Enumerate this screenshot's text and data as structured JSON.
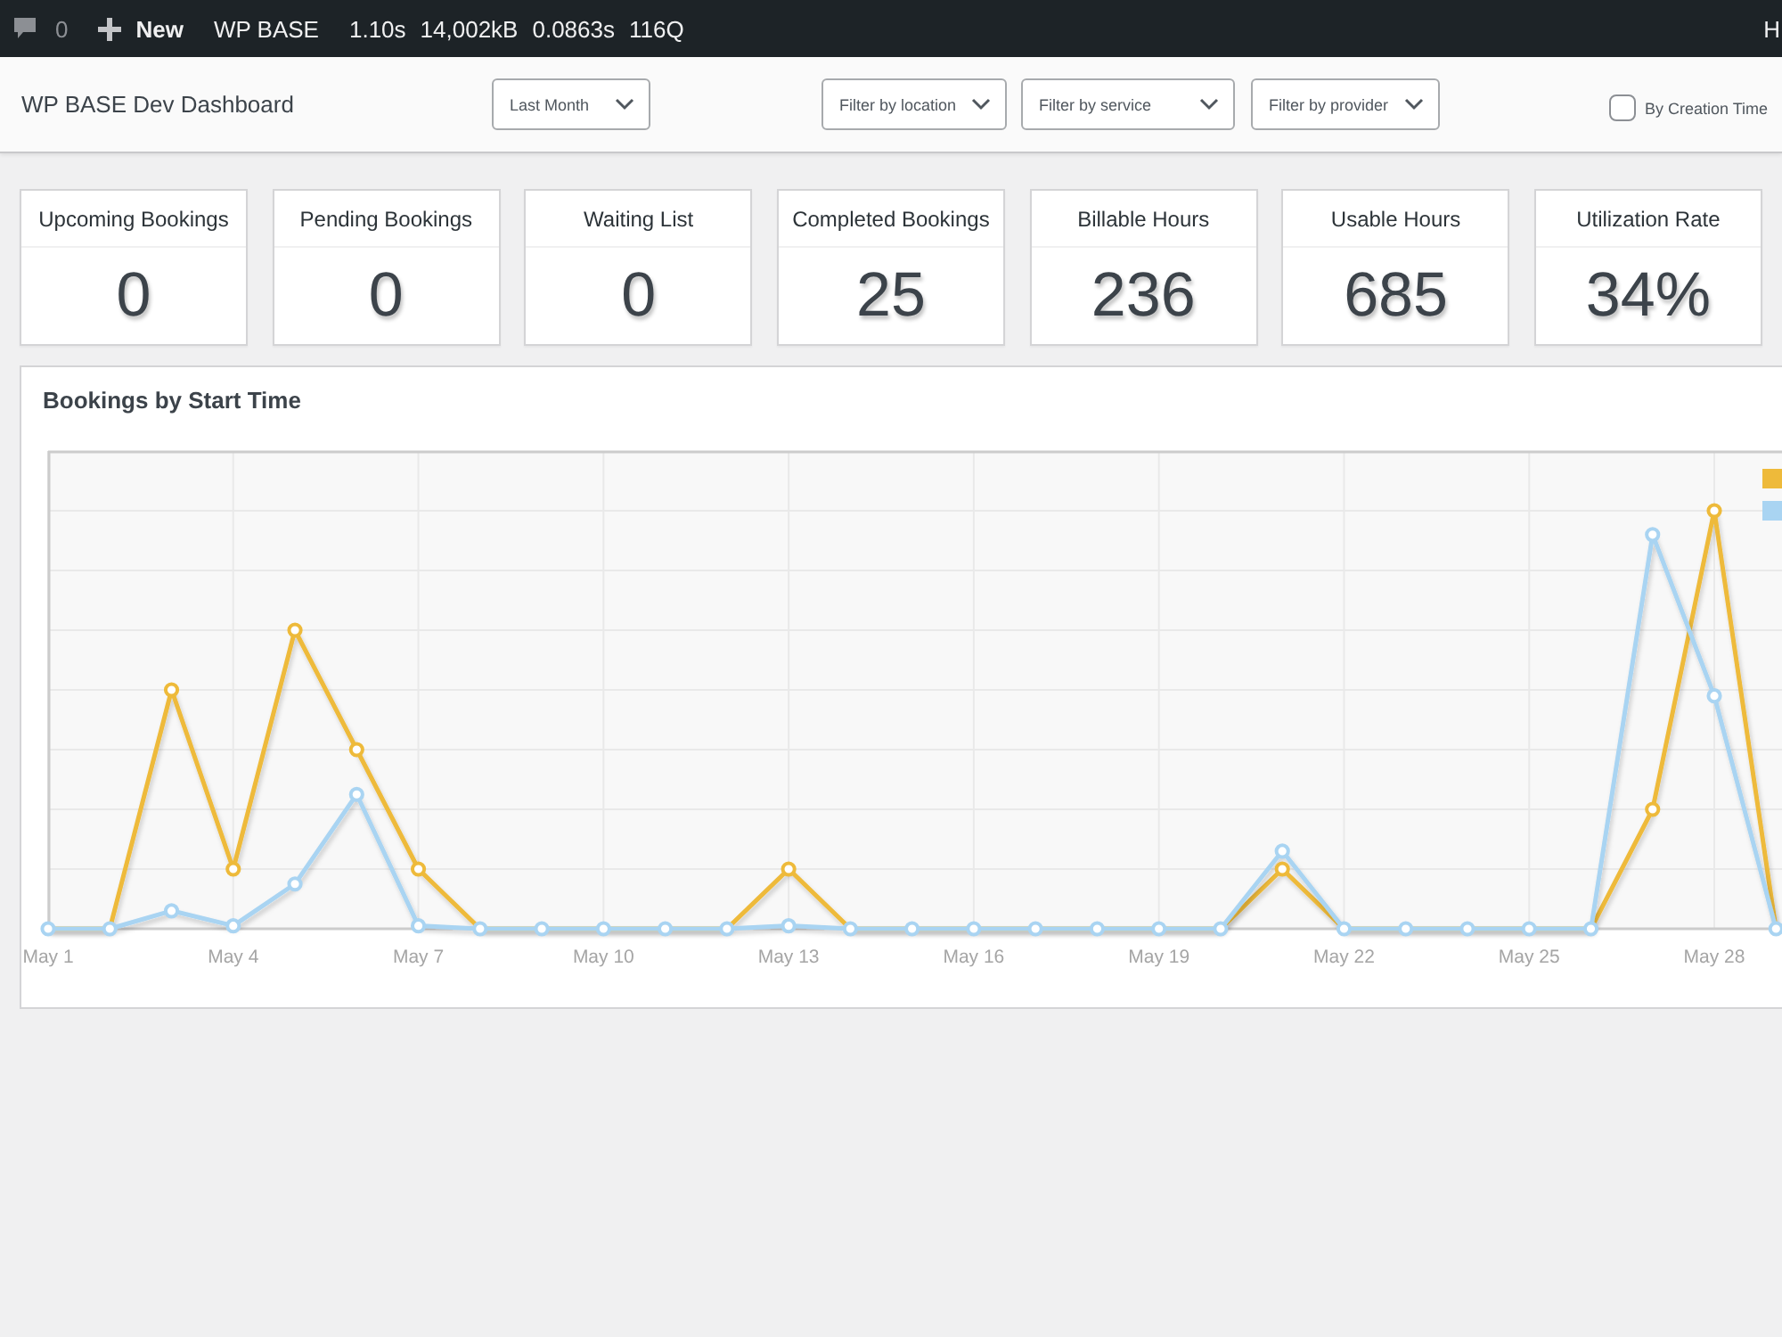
{
  "admin_bar": {
    "comments_count": "0",
    "new_label": "New",
    "site_name": "WP BASE",
    "stats": [
      "1.10s",
      "14,002kB",
      "0.0863s",
      "116Q"
    ],
    "account": "H"
  },
  "header": {
    "title": "WP BASE Dev Dashboard",
    "period": {
      "value": "Last Month"
    },
    "filters": [
      {
        "placeholder": "Filter by location"
      },
      {
        "placeholder": "Filter by service"
      },
      {
        "placeholder": "Filter by provider"
      }
    ],
    "creation_time": {
      "label": "By Creation Time",
      "checked": false
    }
  },
  "stats": [
    {
      "label": "Upcoming Bookings",
      "value": "0"
    },
    {
      "label": "Pending Bookings",
      "value": "0"
    },
    {
      "label": "Waiting List",
      "value": "0"
    },
    {
      "label": "Completed Bookings",
      "value": "25"
    },
    {
      "label": "Billable Hours",
      "value": "236"
    },
    {
      "label": "Usable Hours",
      "value": "685"
    },
    {
      "label": "Utilization Rate",
      "value": "34%"
    }
  ],
  "chart_panel": {
    "title": "Bookings by Start Time",
    "x_labels": [
      "May 1",
      "May 4",
      "May 7",
      "May 10",
      "May 13",
      "May 16",
      "May 19",
      "May 22",
      "May 25",
      "May 28"
    ],
    "legend": [
      {
        "color": "#eeba3a"
      },
      {
        "color": "#a9d4f2"
      }
    ]
  }
}
